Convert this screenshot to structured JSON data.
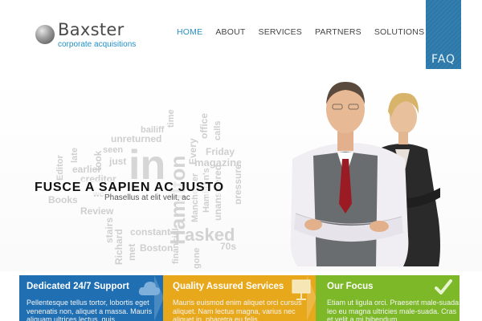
{
  "header": {
    "brand_name": "Baxster",
    "tagline": "corporate acquisitions",
    "nav": [
      {
        "label": "HOME",
        "active": true
      },
      {
        "label": "ABOUT",
        "active": false
      },
      {
        "label": "SERVICES",
        "active": false
      },
      {
        "label": "PARTNERS",
        "active": false
      },
      {
        "label": "SOLUTIONS",
        "active": false
      }
    ],
    "faq_label": "FAQ"
  },
  "hero": {
    "title": "FUSCE A SAPIEN AC JUSTO",
    "subtitle": "Phasellus at elit velit, ac",
    "cloud_words": [
      "bailiff",
      "time",
      "unreturned",
      "office",
      "calls",
      "seen",
      "took",
      "Every",
      "Friday",
      "just",
      "Editor",
      "late",
      "earlier",
      "creditor",
      "in",
      "magazine",
      "Hamilton",
      "Hamilton's",
      "worn",
      "unanswered",
      "Books",
      "Review",
      "stairs",
      "Richard",
      "met",
      "constant",
      "pressure",
      "asked",
      "financial",
      "Manchester",
      "gone",
      "Boston",
      "70s"
    ]
  },
  "features": [
    {
      "title": "Dedicated 24/7 Support",
      "text": "Pellentesque tellus tortor, lobortis eget venenatis non, aliquet a massa. Mauris aliquam ultrices lectus, quis",
      "icon": "cloud-icon",
      "color": "#1f6fb2"
    },
    {
      "title": "Quality Assured Services",
      "text": "Mauris euismod enim aliquet orci cursus aliquet. Nam lectus magna, varius nec aliquet in, pharetra eu felis.",
      "icon": "presentation-board-icon",
      "color": "#e8a81b"
    },
    {
      "title": "Our Focus",
      "text": "Etiam ut ligula orci. Praesent male-suada leo eu magna ultricies male-suada. Cras et velit a mi bibendum",
      "icon": "checkmark-icon",
      "color": "#7cb828"
    }
  ],
  "colors": {
    "accent": "#2a8fc4",
    "faq_tab": "#2c77a6",
    "support_blue": "#1f6fb2",
    "services_orange": "#e8a81b",
    "focus_green": "#7cb828"
  }
}
